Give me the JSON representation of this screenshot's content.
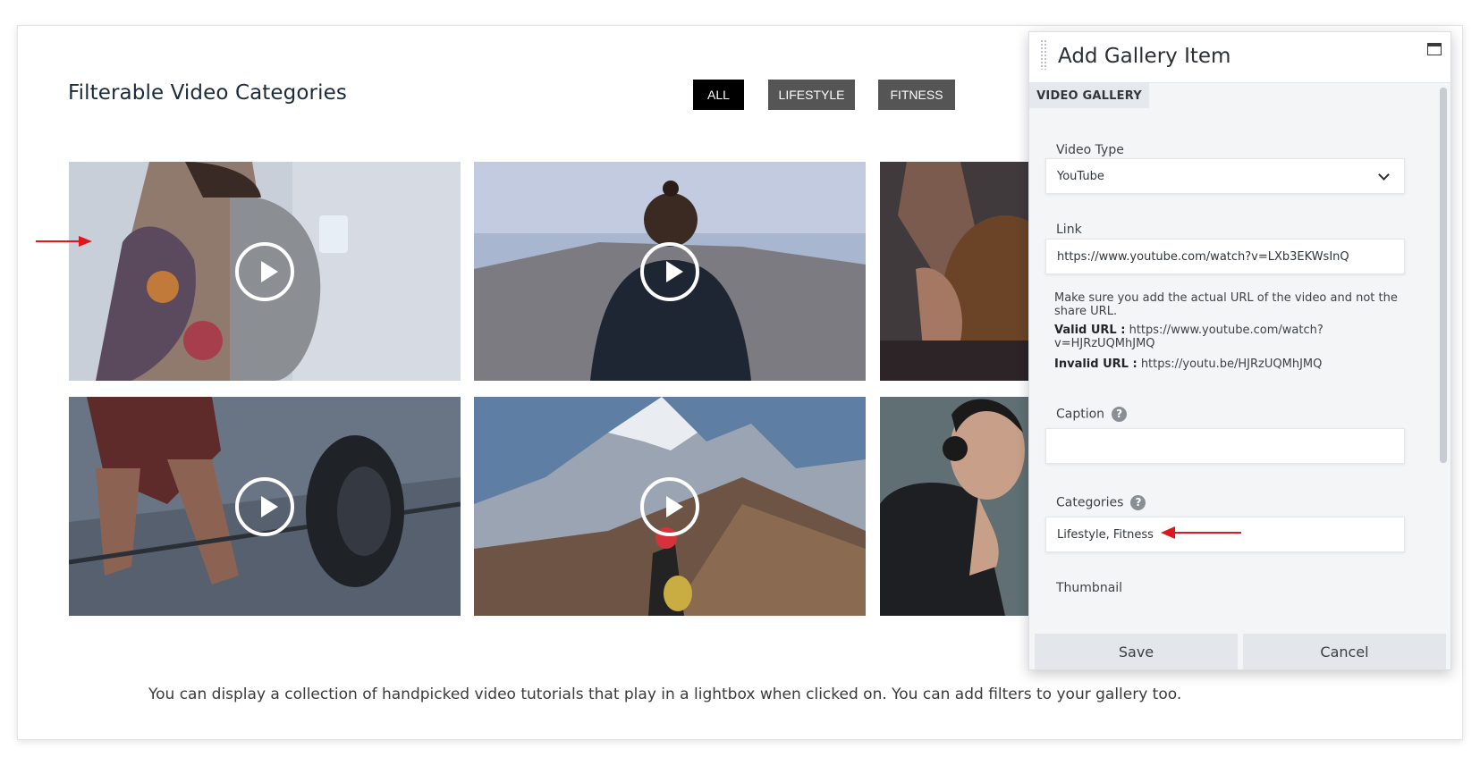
{
  "page": {
    "title": "Filterable Video Categories",
    "description": "You can display a collection of handpicked video tutorials that play in a lightbox when clicked on. You can add filters to your gallery too."
  },
  "filters": [
    {
      "label": "ALL",
      "active": true
    },
    {
      "label": "LIFESTYLE",
      "active": false
    },
    {
      "label": "FITNESS",
      "active": false
    }
  ],
  "panel": {
    "title": "Add Gallery Item",
    "tab": "VIDEO GALLERY",
    "video_type": {
      "label": "Video Type",
      "value": "YouTube"
    },
    "link": {
      "label": "Link",
      "value": "https://www.youtube.com/watch?v=LXb3EKWsInQ"
    },
    "help": {
      "note": "Make sure you add the actual URL of the video and not the share URL.",
      "valid_label": "Valid URL :",
      "valid_value": "https://www.youtube.com/watch?v=HJRzUQMhJMQ",
      "invalid_label": "Invalid URL :",
      "invalid_value": "https://youtu.be/HJRzUQMhJMQ"
    },
    "caption": {
      "label": "Caption",
      "value": ""
    },
    "categories": {
      "label": "Categories",
      "value": "Lifestyle, Fitness"
    },
    "thumbnail": {
      "label": "Thumbnail"
    },
    "save_label": "Save",
    "cancel_label": "Cancel"
  },
  "colors": {
    "accent_arrow": "#e0161b",
    "filter_active": "#000000",
    "filter_inactive": "#555555"
  }
}
